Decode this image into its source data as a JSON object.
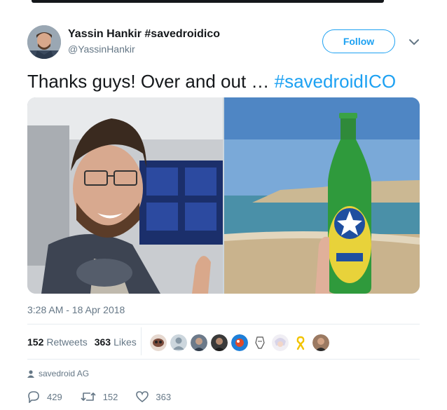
{
  "user": {
    "display_name": "Yassin Hankir #savedroidico",
    "handle": "@YassinHankir",
    "avatar_icon": "profile-photo"
  },
  "follow_label": "Follow",
  "caret_icon": "chevron-down-icon",
  "tweet": {
    "text_plain": "Thanks guys! Over and out … ",
    "hashtag": "#savedroidICO"
  },
  "media": [
    {
      "description_icon": "selfie-airport-photo"
    },
    {
      "description_icon": "beer-bottle-beach-photo"
    }
  ],
  "timestamp": "3:28 AM - 18 Apr 2018",
  "stats": {
    "retweets_count": "152",
    "retweets_label": "Retweets",
    "likes_count": "363",
    "likes_label": "Likes"
  },
  "likers": [
    {
      "icon": "liker-avatar"
    },
    {
      "icon": "liker-avatar"
    },
    {
      "icon": "liker-avatar"
    },
    {
      "icon": "liker-avatar"
    },
    {
      "icon": "liker-avatar"
    },
    {
      "icon": "liker-avatar"
    },
    {
      "icon": "liker-avatar"
    },
    {
      "icon": "ribbon-icon"
    },
    {
      "icon": "liker-avatar"
    }
  ],
  "source": {
    "icon": "person-icon",
    "label": "savedroid AG"
  },
  "actions": {
    "reply_count": "429",
    "retweet_count": "152",
    "like_count": "363"
  },
  "colors": {
    "accent": "#1da1f2",
    "text": "#14171a",
    "muted": "#657786",
    "divider": "#e6ecf0"
  }
}
